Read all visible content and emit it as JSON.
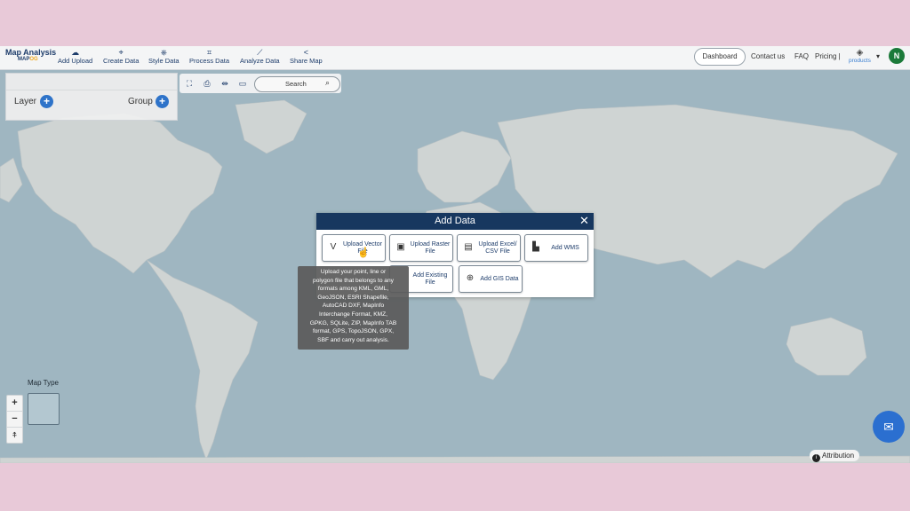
{
  "brand": {
    "title": "Map Analysis",
    "sub_main": "MAP",
    "sub_accent": "OG"
  },
  "nav": {
    "items": [
      {
        "label": "Add Upload",
        "icon": "cloud-upload-icon"
      },
      {
        "label": "Create Data",
        "icon": "map-pin-icon"
      },
      {
        "label": "Style Data",
        "icon": "style-icon"
      },
      {
        "label": "Process Data",
        "icon": "process-icon"
      },
      {
        "label": "Analyze Data",
        "icon": "analyze-icon"
      },
      {
        "label": "Share Map",
        "icon": "share-icon"
      }
    ]
  },
  "header_right": {
    "dashboard": "Dashboard",
    "contact": "Contact us",
    "faq": "FAQ",
    "pricing": "Pricing |",
    "products": "products",
    "avatar_letter": "N"
  },
  "layer_panel": {
    "layer_label": "Layer",
    "group_label": "Group"
  },
  "search": {
    "placeholder": "Search"
  },
  "map_type": {
    "label": "Map Type"
  },
  "zoom": {
    "in": "+",
    "out": "−",
    "reset": "⍏"
  },
  "dialog": {
    "title": "Add Data",
    "close": "✕",
    "options": [
      {
        "label": "Upload Vector File",
        "icon": "vector-icon"
      },
      {
        "label": "Upload Raster File",
        "icon": "raster-icon"
      },
      {
        "label": "Upload Excel/ CSV File",
        "icon": "table-icon"
      },
      {
        "label": "Add WMS",
        "icon": "wms-icon"
      },
      {
        "label": "Add Existing File",
        "icon": "file-icon"
      },
      {
        "label": "Add GIS Data",
        "icon": "globe-icon"
      }
    ]
  },
  "tooltip": {
    "lines": [
      "Upload your point, line or",
      "polygon file that belongs to any",
      "formats among KML, GML,",
      "GeoJSON, ESRI Shapefile,",
      "AutoCAD DXF, MapInfo",
      "Interchange Format, KMZ,",
      "GPKG, SQLite, ZIP, MapInfo TAB",
      "format, GPS, TopoJSON, GPX,",
      "SBF and carry out analysis."
    ]
  },
  "attribution": "Attribution",
  "colors": {
    "header_navy": "#17375f",
    "accent_blue": "#2e73c9",
    "ocean": "#9fb6c1",
    "land": "#cdd3d3",
    "avatar_green": "#1b7a3a"
  }
}
